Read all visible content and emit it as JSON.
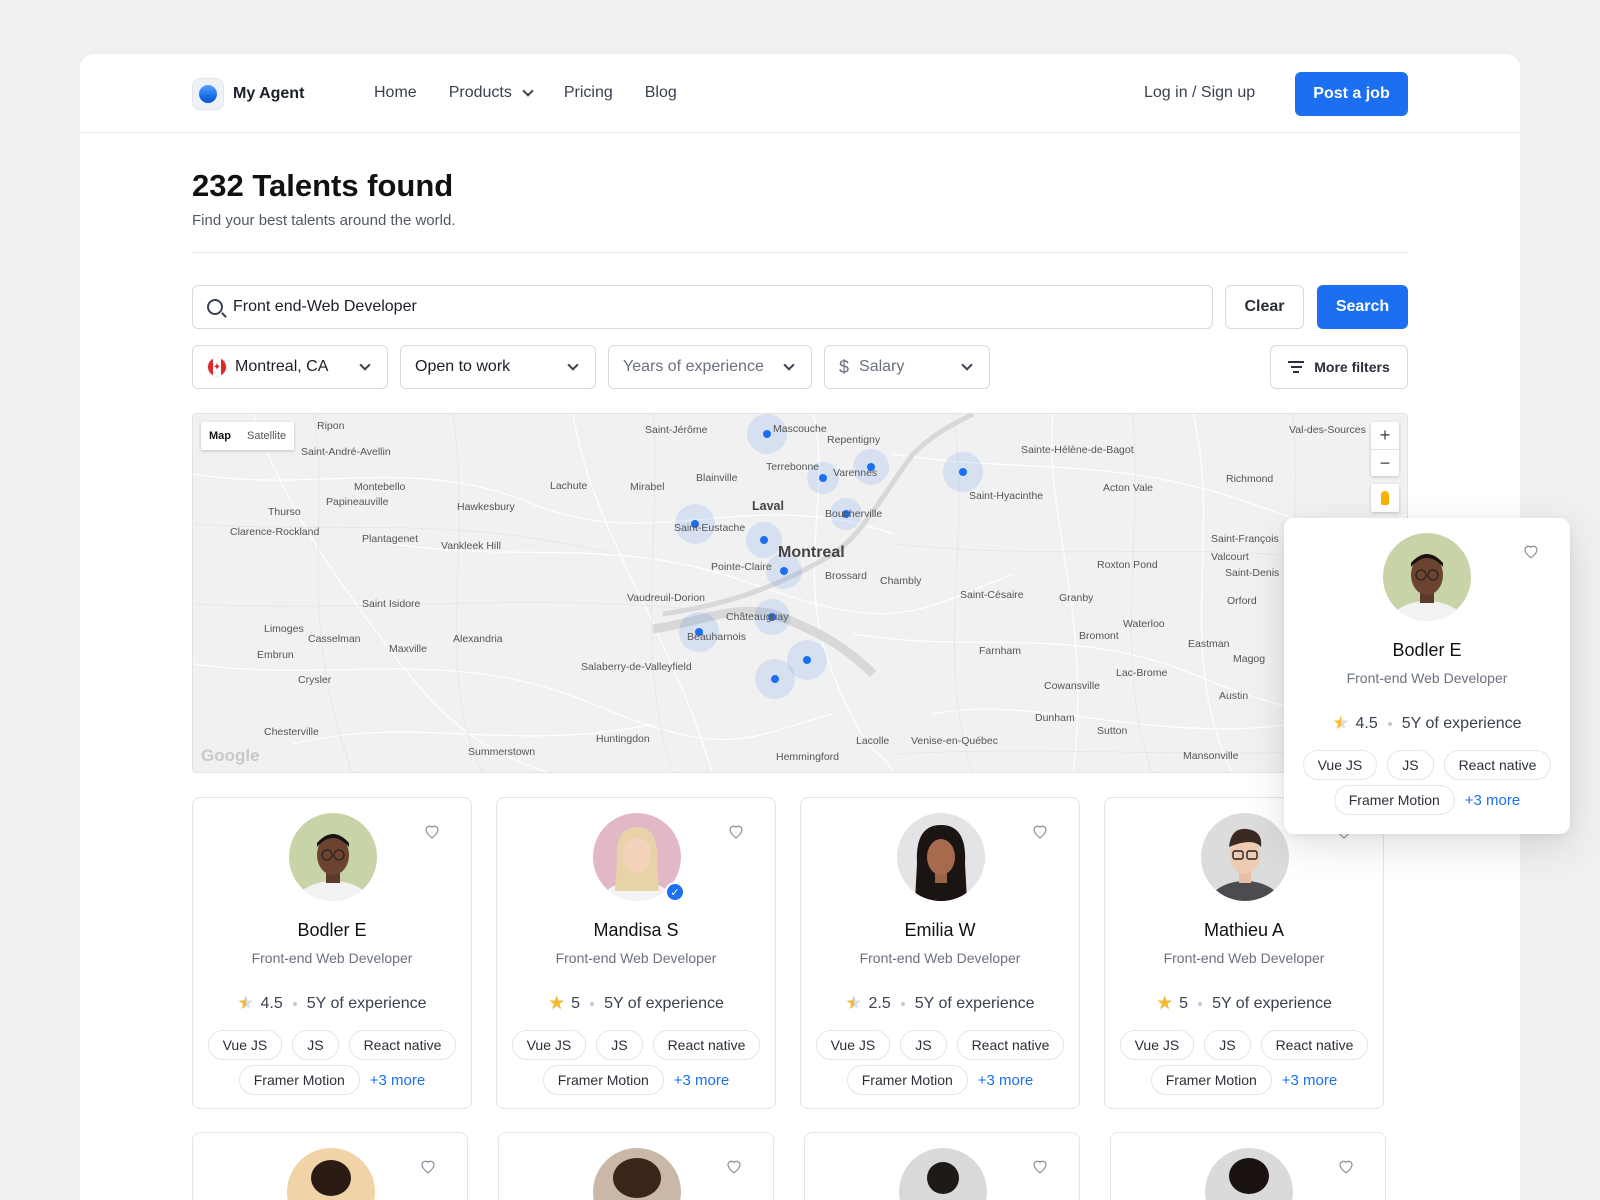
{
  "header": {
    "brand": "My Agent",
    "nav": [
      {
        "label": "Home"
      },
      {
        "label": "Products"
      },
      {
        "label": "Pricing"
      },
      {
        "label": "Blog"
      }
    ],
    "login": "Log in / Sign up",
    "post_job": "Post a job",
    "accent": "#1b6ff0"
  },
  "page": {
    "title": "232 Talents found",
    "subtitle": "Find your best talents around the world."
  },
  "search": {
    "value": "Front end-Web Developer",
    "clear_label": "Clear",
    "search_label": "Search"
  },
  "filters": {
    "location": "Montreal, CA",
    "status": "Open to work",
    "experience_placeholder": "Years of experience",
    "salary_placeholder": "Salary",
    "more_label": "More filters"
  },
  "map": {
    "toggle_map": "Map",
    "toggle_satellite": "Satellite",
    "zoom_in": "+",
    "zoom_out": "−",
    "attribution": "Google",
    "places": [
      "Ripon",
      "Saint-André-Avellin",
      "Montebello",
      "Papineauville",
      "Thurso",
      "Clarence-Rockland",
      "Plantagenet",
      "Hawkesbury",
      "Vankleek Hill",
      "Lachute",
      "Mirabel",
      "Saint-Jérôme",
      "Mascouche",
      "Repentigny",
      "Blainville",
      "Terrebonne",
      "Varennes",
      "Laval",
      "Boucherville",
      "Saint-Eustache",
      "Montreal",
      "Pointe-Claire",
      "Brossard",
      "Chambly",
      "Vaudreuil-Dorion",
      "Châteauguay",
      "Beauharnois",
      "Salaberry-de-Valleyfield",
      "Saint Isidore",
      "Limoges",
      "Casselman",
      "Embrun",
      "Maxville",
      "Alexandria",
      "Crysler",
      "Chesterville",
      "Summerstown",
      "Huntingdon",
      "Hemmingford",
      "Lacolle",
      "Venise-en-Québec",
      "Dunham",
      "Sutton",
      "Cowansville",
      "Lac-Brome",
      "Farnham",
      "Saint-Césaire",
      "Granby",
      "Bromont",
      "Waterloo",
      "Eastman",
      "Austin",
      "Mansonville",
      "Roxton Pond",
      "Valcourt",
      "Saint-François",
      "Saint-Denis",
      "Orford",
      "Magog",
      "Acton Vale",
      "Richmond",
      "Sainte-Hélène-de-Bagot",
      "Saint-Hyacinthe",
      "Val-des-Sources"
    ]
  },
  "cards": [
    {
      "name": "Bodler E",
      "role": "Front-end Web Developer",
      "rating": "4.5",
      "experience": "5Y of experience",
      "tags": [
        "Vue JS",
        "JS",
        "React native"
      ],
      "tag_extra": "Framer Motion",
      "more": "+3 more",
      "star": "half"
    },
    {
      "name": "Mandisa S",
      "role": "Front-end Web Developer",
      "rating": "5",
      "experience": "5Y of experience",
      "tags": [
        "Vue JS",
        "JS",
        "React native"
      ],
      "tag_extra": "Framer Motion",
      "more": "+3 more",
      "star": "full"
    },
    {
      "name": "Emilia W",
      "role": "Front-end Web Developer",
      "rating": "2.5",
      "experience": "5Y of experience",
      "tags": [
        "Vue JS",
        "JS",
        "React native"
      ],
      "tag_extra": "Framer Motion",
      "more": "+3 more",
      "star": "half"
    },
    {
      "name": "Mathieu A",
      "role": "Front-end Web Developer",
      "rating": "5",
      "experience": "5Y of experience",
      "tags": [
        "Vue JS",
        "JS",
        "React native"
      ],
      "tag_extra": "Framer Motion",
      "more": "+3 more",
      "star": "full"
    }
  ],
  "popup": {
    "name": "Bodler E",
    "role": "Front-end Web Developer",
    "rating": "4.5",
    "experience": "5Y of experience",
    "tags": [
      "Vue JS",
      "JS",
      "React native"
    ],
    "tag_extra": "Framer Motion",
    "more": "+3 more"
  }
}
